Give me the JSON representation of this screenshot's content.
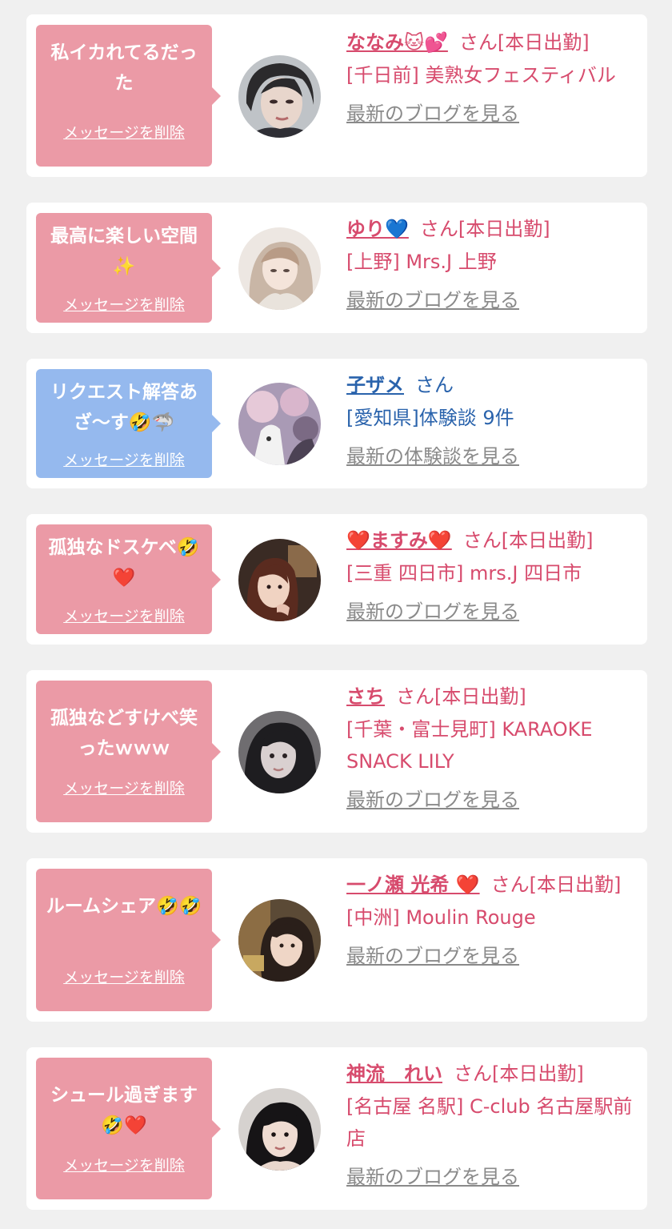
{
  "common": {
    "delete_label": "メッセージを削除",
    "san_label": "さん"
  },
  "colors": {
    "bubble_pink": "#eb9aa6",
    "bubble_blue": "#95b9ee",
    "accent_pink": "#d74b6d",
    "accent_blue": "#2a63ac",
    "link_gray": "#8a8a8a"
  },
  "messages": [
    {
      "comment": "私イカれてるだった",
      "name": "ななみ🐱💕",
      "status": "[本日出勤]",
      "shop": "[千日前] 美熟女フェスティバル",
      "more_label": "最新のブログを見る"
    },
    {
      "comment": "最高に楽しい空間✨",
      "name": "ゆり💙",
      "status": "[本日出勤]",
      "shop": "[上野] Mrs.J 上野",
      "more_label": "最新のブログを見る"
    },
    {
      "comment": "リクエスト解答あざ〜す🤣🦈",
      "name": "子ザメ",
      "status": "",
      "shop": "[愛知県]体験談 9件",
      "more_label": "最新の体験談を見る"
    },
    {
      "comment": "孤独なドスケベ🤣❤️",
      "name": "❤️ますみ❤️",
      "status": "[本日出勤]",
      "shop": "[三重 四日市] mrs.J 四日市",
      "more_label": "最新のブログを見る"
    },
    {
      "comment": "孤独などすけべ笑ったｗｗｗ",
      "name": "さち",
      "status": "[本日出勤]",
      "shop": "[千葉・富士見町] KARAOKE SNACK LILY",
      "more_label": "最新のブログを見る"
    },
    {
      "comment": "ルームシェア🤣🤣",
      "name": "一ノ瀬 光希 ❤️",
      "status": "[本日出勤]",
      "shop": "[中洲] Moulin Rouge",
      "more_label": "最新のブログを見る"
    },
    {
      "comment": "シュール過ぎます🤣❤️",
      "name": "神流　れい",
      "status": "[本日出勤]",
      "shop": "[名古屋 名駅] C-club 名古屋駅前店",
      "more_label": "最新のブログを見る"
    }
  ]
}
